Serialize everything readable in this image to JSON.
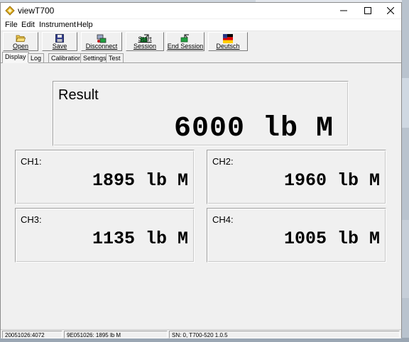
{
  "window": {
    "title": "viewT700"
  },
  "menu": [
    "File",
    "Edit",
    "Instrument",
    "Help"
  ],
  "toolbar": {
    "open": "Open",
    "save": "Save",
    "disconnect": "Disconnect",
    "start_session": "Start Session",
    "end_session": "End Session",
    "language": "Deutsch"
  },
  "tabs": [
    "Display",
    "Log",
    "Calibration",
    "Settings",
    "Test"
  ],
  "active_tab": "Display",
  "result": {
    "label": "Result",
    "value": "6000 lb M"
  },
  "channels": [
    {
      "label": "CH1:",
      "value": "1895 lb M"
    },
    {
      "label": "CH2:",
      "value": "1960 lb M"
    },
    {
      "label": "CH3:",
      "value": "1135 lb M"
    },
    {
      "label": "CH4:",
      "value": "1005 lb M"
    }
  ],
  "status": {
    "left": "20051026:4072",
    "middle": "9E051026:   1895 lb M",
    "right": "SN: 0, T700-520 1.0.5"
  },
  "icons": {
    "app": "app-logo-icon",
    "open": "folder-open-icon",
    "save": "floppy-disk-icon",
    "disconnect": "network-disconnect-icon",
    "start_session": "start-session-icon",
    "end_session": "end-session-icon",
    "language": "german-flag-icon"
  }
}
